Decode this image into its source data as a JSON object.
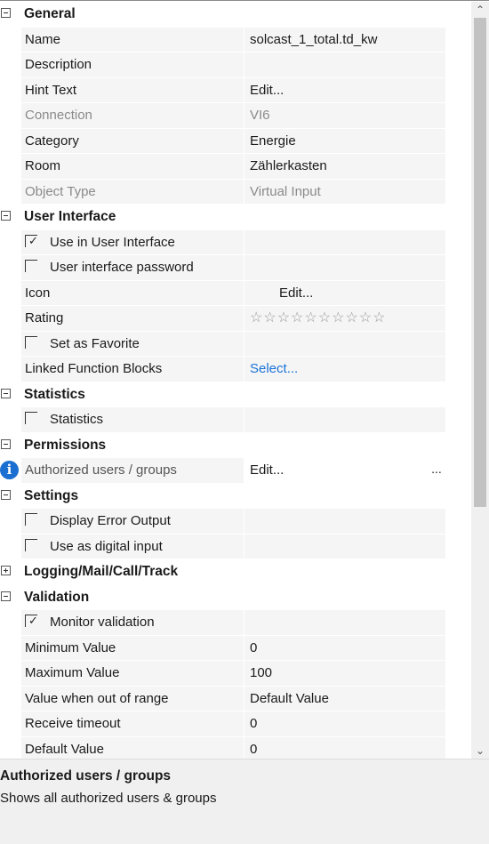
{
  "categories": {
    "general": "General",
    "user_interface": "User Interface",
    "statistics": "Statistics",
    "permissions": "Permissions",
    "settings": "Settings",
    "logging": "Logging/Mail/Call/Track",
    "validation": "Validation"
  },
  "general": {
    "name_label": "Name",
    "name_value": "solcast_1_total.td_kw",
    "description_label": "Description",
    "description_value": "",
    "hint_label": "Hint Text",
    "hint_value": "Edit...",
    "connection_label": "Connection",
    "connection_value": "VI6",
    "category_label": "Category",
    "category_value": "Energie",
    "room_label": "Room",
    "room_value": "Zählerkasten",
    "object_type_label": "Object Type",
    "object_type_value": "Virtual Input"
  },
  "user_interface": {
    "use_in_ui_label": "Use in User Interface",
    "use_in_ui_checked": true,
    "ui_password_label": "User interface password",
    "ui_password_checked": false,
    "icon_label": "Icon",
    "icon_value": "Edit...",
    "rating_label": "Rating",
    "rating_stars": "☆☆☆☆☆☆☆☆☆☆",
    "rating_value": 0,
    "favorite_label": "Set as Favorite",
    "favorite_checked": false,
    "linked_label": "Linked Function Blocks",
    "linked_value": "Select..."
  },
  "statistics": {
    "statistics_label": "Statistics",
    "statistics_checked": false
  },
  "permissions": {
    "authorized_label": "Authorized users / groups",
    "authorized_value": "Edit...",
    "ellipsis": "..."
  },
  "settings": {
    "error_output_label": "Display Error Output",
    "error_output_checked": false,
    "digital_input_label": "Use as digital input",
    "digital_input_checked": false
  },
  "validation": {
    "monitor_label": "Monitor validation",
    "monitor_checked": true,
    "min_label": "Minimum Value",
    "min_value": "0",
    "max_label": "Maximum Value",
    "max_value": "100",
    "out_of_range_label": "Value when out of range",
    "out_of_range_value": "Default Value",
    "receive_timeout_label": "Receive timeout",
    "receive_timeout_value": "0",
    "default_label": "Default Value",
    "default_value": "0"
  },
  "glyphs": {
    "check": "✓",
    "info": "i",
    "scroll_up": "⌃",
    "scroll_down": "⌄"
  },
  "description_panel": {
    "title": "Authorized users / groups",
    "text": "Shows all authorized users & groups"
  },
  "colors": {
    "link": "#1a73d8",
    "info_icon": "#1a6fd0",
    "row_bg": "#f5f5f5",
    "disabled_text": "#8a8a8a"
  }
}
